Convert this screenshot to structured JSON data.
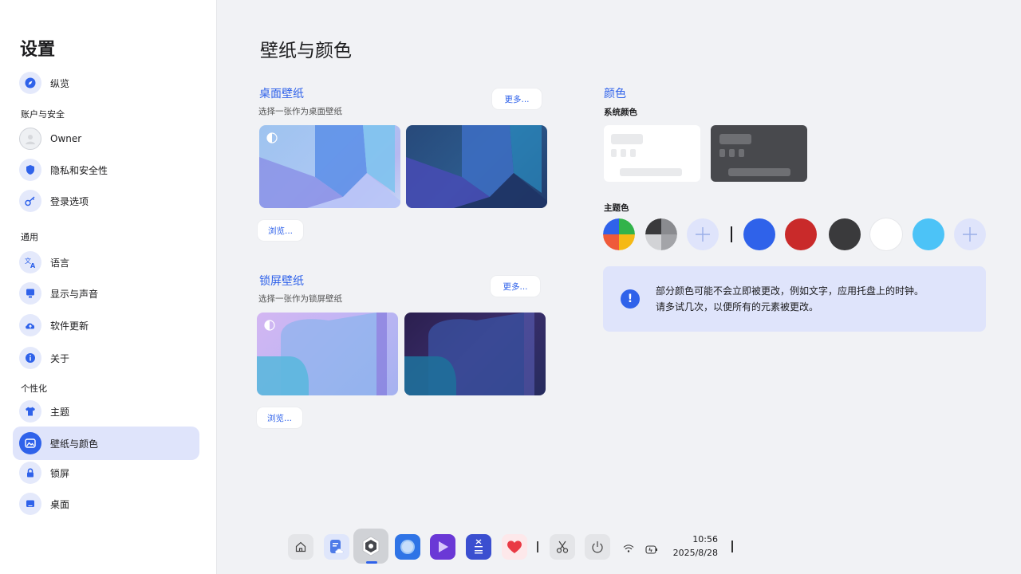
{
  "sidebar": {
    "title": "设置",
    "sections": {
      "account": "账户与安全",
      "general": "通用",
      "personalization": "个性化"
    },
    "items": [
      {
        "label": "纵览",
        "icon": "compass-icon"
      },
      {
        "label": "Owner",
        "icon": "avatar-icon"
      },
      {
        "label": "隐私和安全性",
        "icon": "shield-icon"
      },
      {
        "label": "登录选项",
        "icon": "key-icon"
      },
      {
        "label": "语言",
        "icon": "translate-icon"
      },
      {
        "label": "显示与声音",
        "icon": "monitor-icon"
      },
      {
        "label": "软件更新",
        "icon": "cloud-upload-icon"
      },
      {
        "label": "关于",
        "icon": "info-icon"
      },
      {
        "label": "主题",
        "icon": "shirt-icon"
      },
      {
        "label": "壁纸与颜色",
        "icon": "image-icon",
        "active": true
      },
      {
        "label": "锁屏",
        "icon": "lock-icon"
      },
      {
        "label": "桌面",
        "icon": "desktop-icon"
      }
    ]
  },
  "main": {
    "title": "壁纸与颜色",
    "desktop_wallpaper": {
      "title": "桌面壁纸",
      "subtitle": "选择一张作为桌面壁纸",
      "more_label": "更多...",
      "browse_label": "浏览..."
    },
    "lock_wallpaper": {
      "title": "锁屏壁纸",
      "subtitle": "选择一张作为锁屏壁纸",
      "more_label": "更多...",
      "browse_label": "浏览..."
    },
    "color": {
      "title": "颜色",
      "system_color_label": "系统颜色",
      "theme_color_label": "主题色",
      "theme_colors": [
        "#2f62ea",
        "#c92a2a",
        "#3a3a3c",
        "#ffffff",
        "#4cc3f7"
      ],
      "notice": "部分颜色可能不会立即被更改，例如文字，应用托盘上的时钟。请多试几次，以便所有的元素被更改。"
    }
  },
  "taskbar": {
    "apps": [
      "home-icon",
      "notes-weather-icon",
      "settings-icon",
      "browser-icon",
      "video-player-icon",
      "calculator-icon",
      "health-heart-icon",
      "scissors-icon",
      "power-icon"
    ],
    "time": "10:56",
    "date": "2025/8/28"
  }
}
